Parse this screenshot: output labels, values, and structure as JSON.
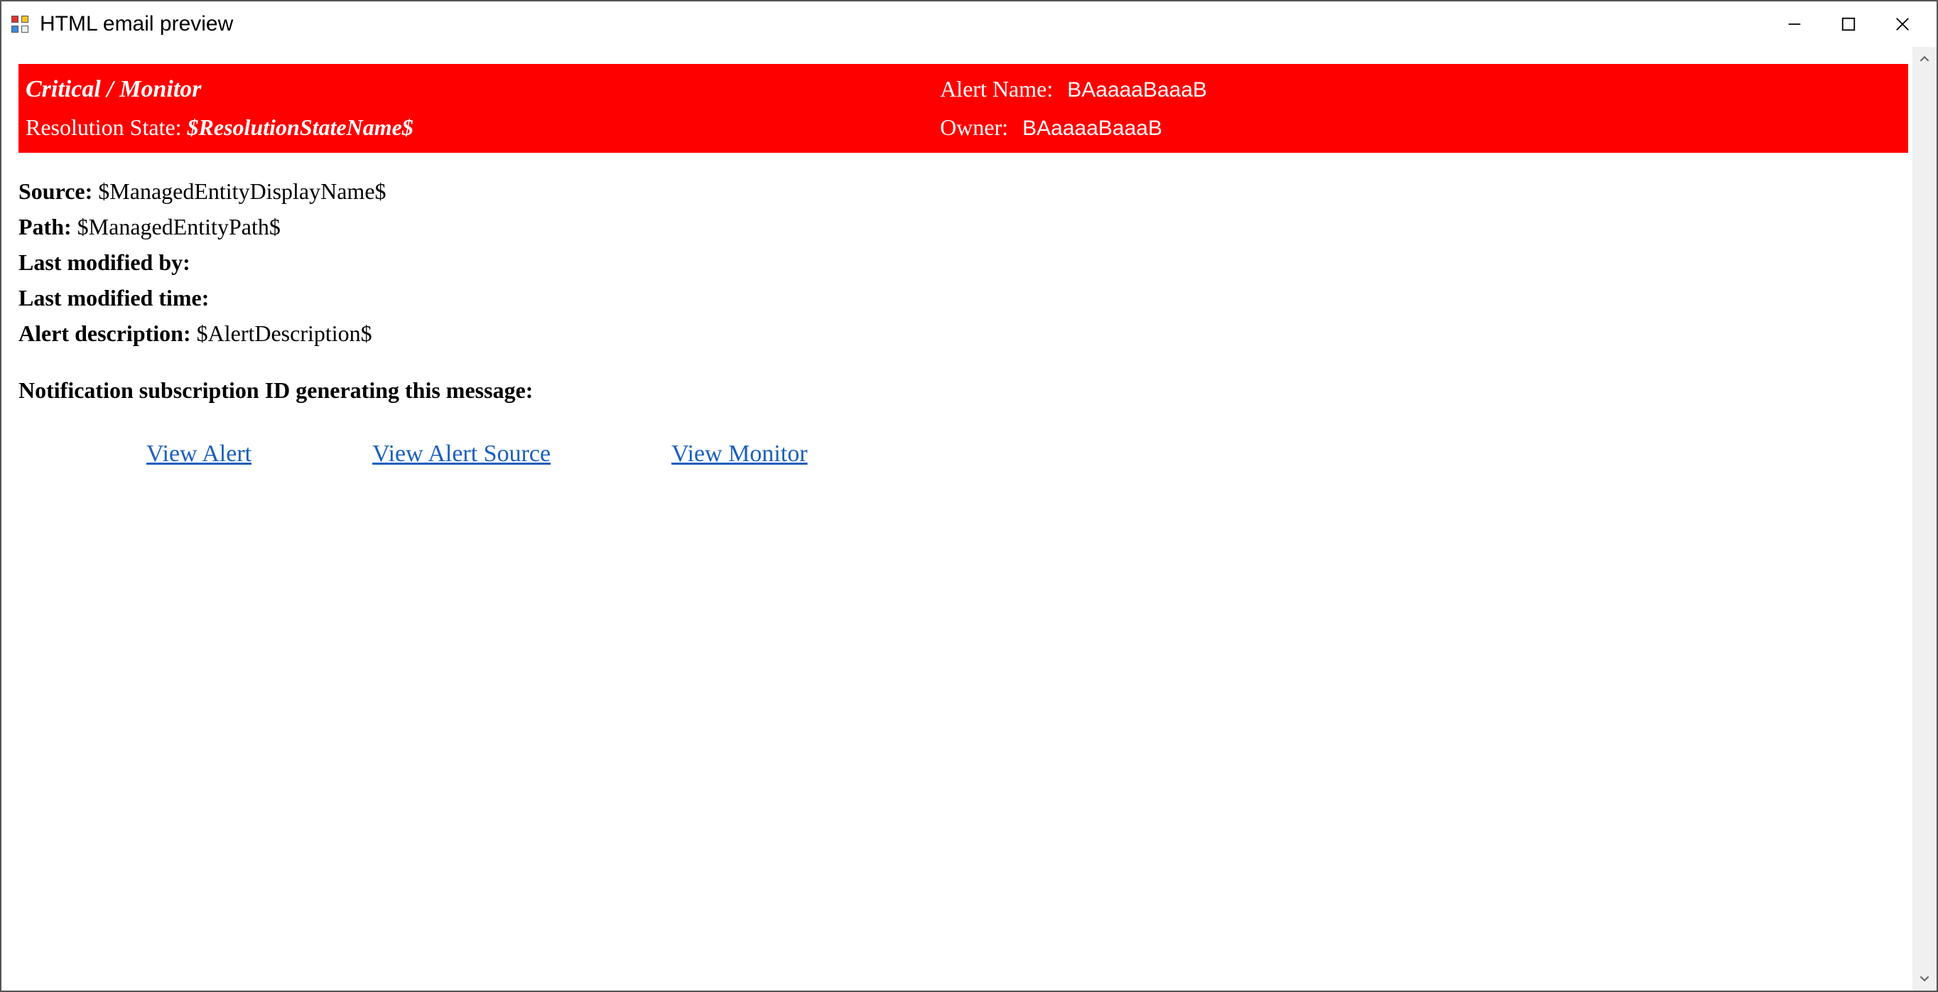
{
  "window": {
    "title": "HTML email preview"
  },
  "banner": {
    "severity_source": "Critical / Monitor",
    "alert_name_label": "Alert Name:",
    "alert_name_value": "BAaaaaBaaaB",
    "resolution_state_label": "Resolution State:",
    "resolution_state_value": "$ResolutionStateName$",
    "owner_label": "Owner:",
    "owner_value": "BAaaaaBaaaB"
  },
  "details": {
    "source_label": "Source:",
    "source_value": "$ManagedEntityDisplayName$",
    "path_label": "Path:",
    "path_value": "$ManagedEntityPath$",
    "last_modified_by_label": "Last modified by:",
    "last_modified_by_value": "",
    "last_modified_time_label": "Last modified time:",
    "last_modified_time_value": "",
    "alert_description_label": "Alert description:",
    "alert_description_value": "$AlertDescription$",
    "subscription_id_label": "Notification subscription ID generating this message:",
    "subscription_id_value": ""
  },
  "links": {
    "view_alert": "View Alert",
    "view_alert_source": "View Alert Source",
    "view_monitor": "View Monitor"
  }
}
